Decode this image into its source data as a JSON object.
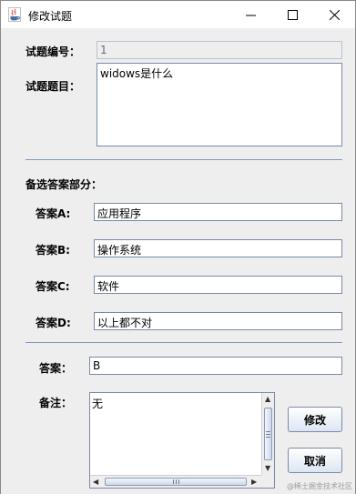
{
  "window": {
    "title": "修改试题"
  },
  "form": {
    "id_label": "试题编号：",
    "id_value": "1",
    "question_label": "试题题目：",
    "question_value": "widows是什么",
    "options_section_label": "备选答案部分：",
    "option_a_label": "答案A:",
    "option_a_value": "应用程序",
    "option_b_label": "答案B:",
    "option_b_value": "操作系统",
    "option_c_label": "答案C:",
    "option_c_value": "软件",
    "option_d_label": "答案D:",
    "option_d_value": "以上都不对",
    "answer_label": "答案：",
    "answer_value": "B",
    "remark_label": "备注：",
    "remark_value": "无"
  },
  "buttons": {
    "modify_label": "修改",
    "cancel_label": "取消"
  },
  "watermark": "@稀土掘金技术社区"
}
